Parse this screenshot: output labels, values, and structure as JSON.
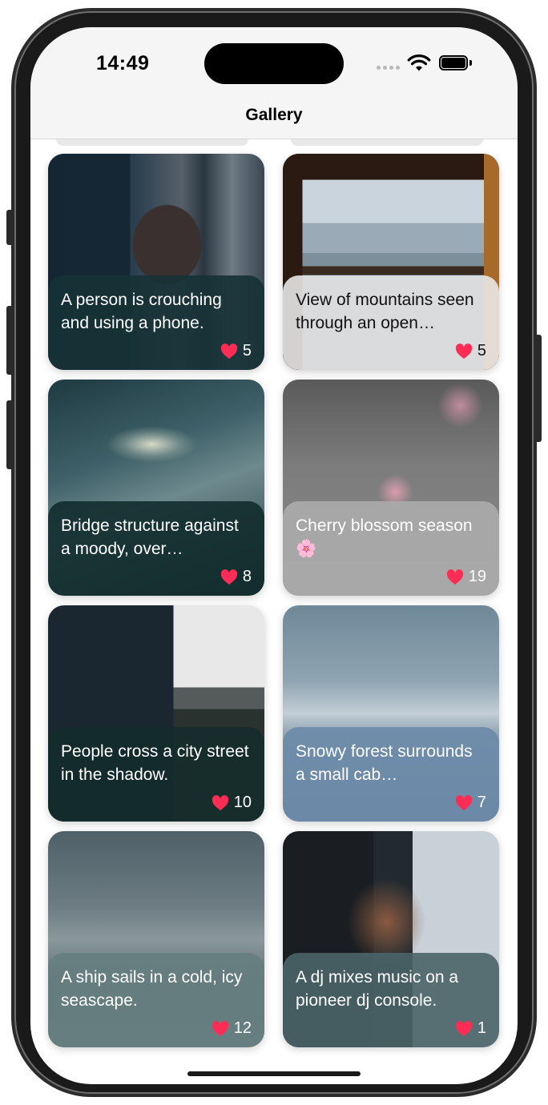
{
  "status_bar": {
    "time": "14:49"
  },
  "nav": {
    "title": "Gallery"
  },
  "cards": [
    {
      "caption": "A person is crouching and using a phone.",
      "likes": "5"
    },
    {
      "caption": "View of mountains seen through an open…",
      "likes": "5"
    },
    {
      "caption": "Bridge structure against a moody, over…",
      "likes": "8"
    },
    {
      "caption": "Cherry blossom season 🌸",
      "likes": "19"
    },
    {
      "caption": "People cross a city street in the shadow.",
      "likes": "10"
    },
    {
      "caption": "Snowy forest surrounds a small cab…",
      "likes": "7"
    },
    {
      "caption": "A ship sails in a cold, icy seascape.",
      "likes": "12"
    },
    {
      "caption": "A dj mixes music on a pioneer dj console.",
      "likes": "1"
    }
  ],
  "colors": {
    "heart": "#ff2d55",
    "nav_background": "#f5f5f5"
  },
  "icons": {
    "like": "heart-icon",
    "wifi": "wifi-icon",
    "battery": "battery-icon",
    "signal": "signal-icon"
  }
}
